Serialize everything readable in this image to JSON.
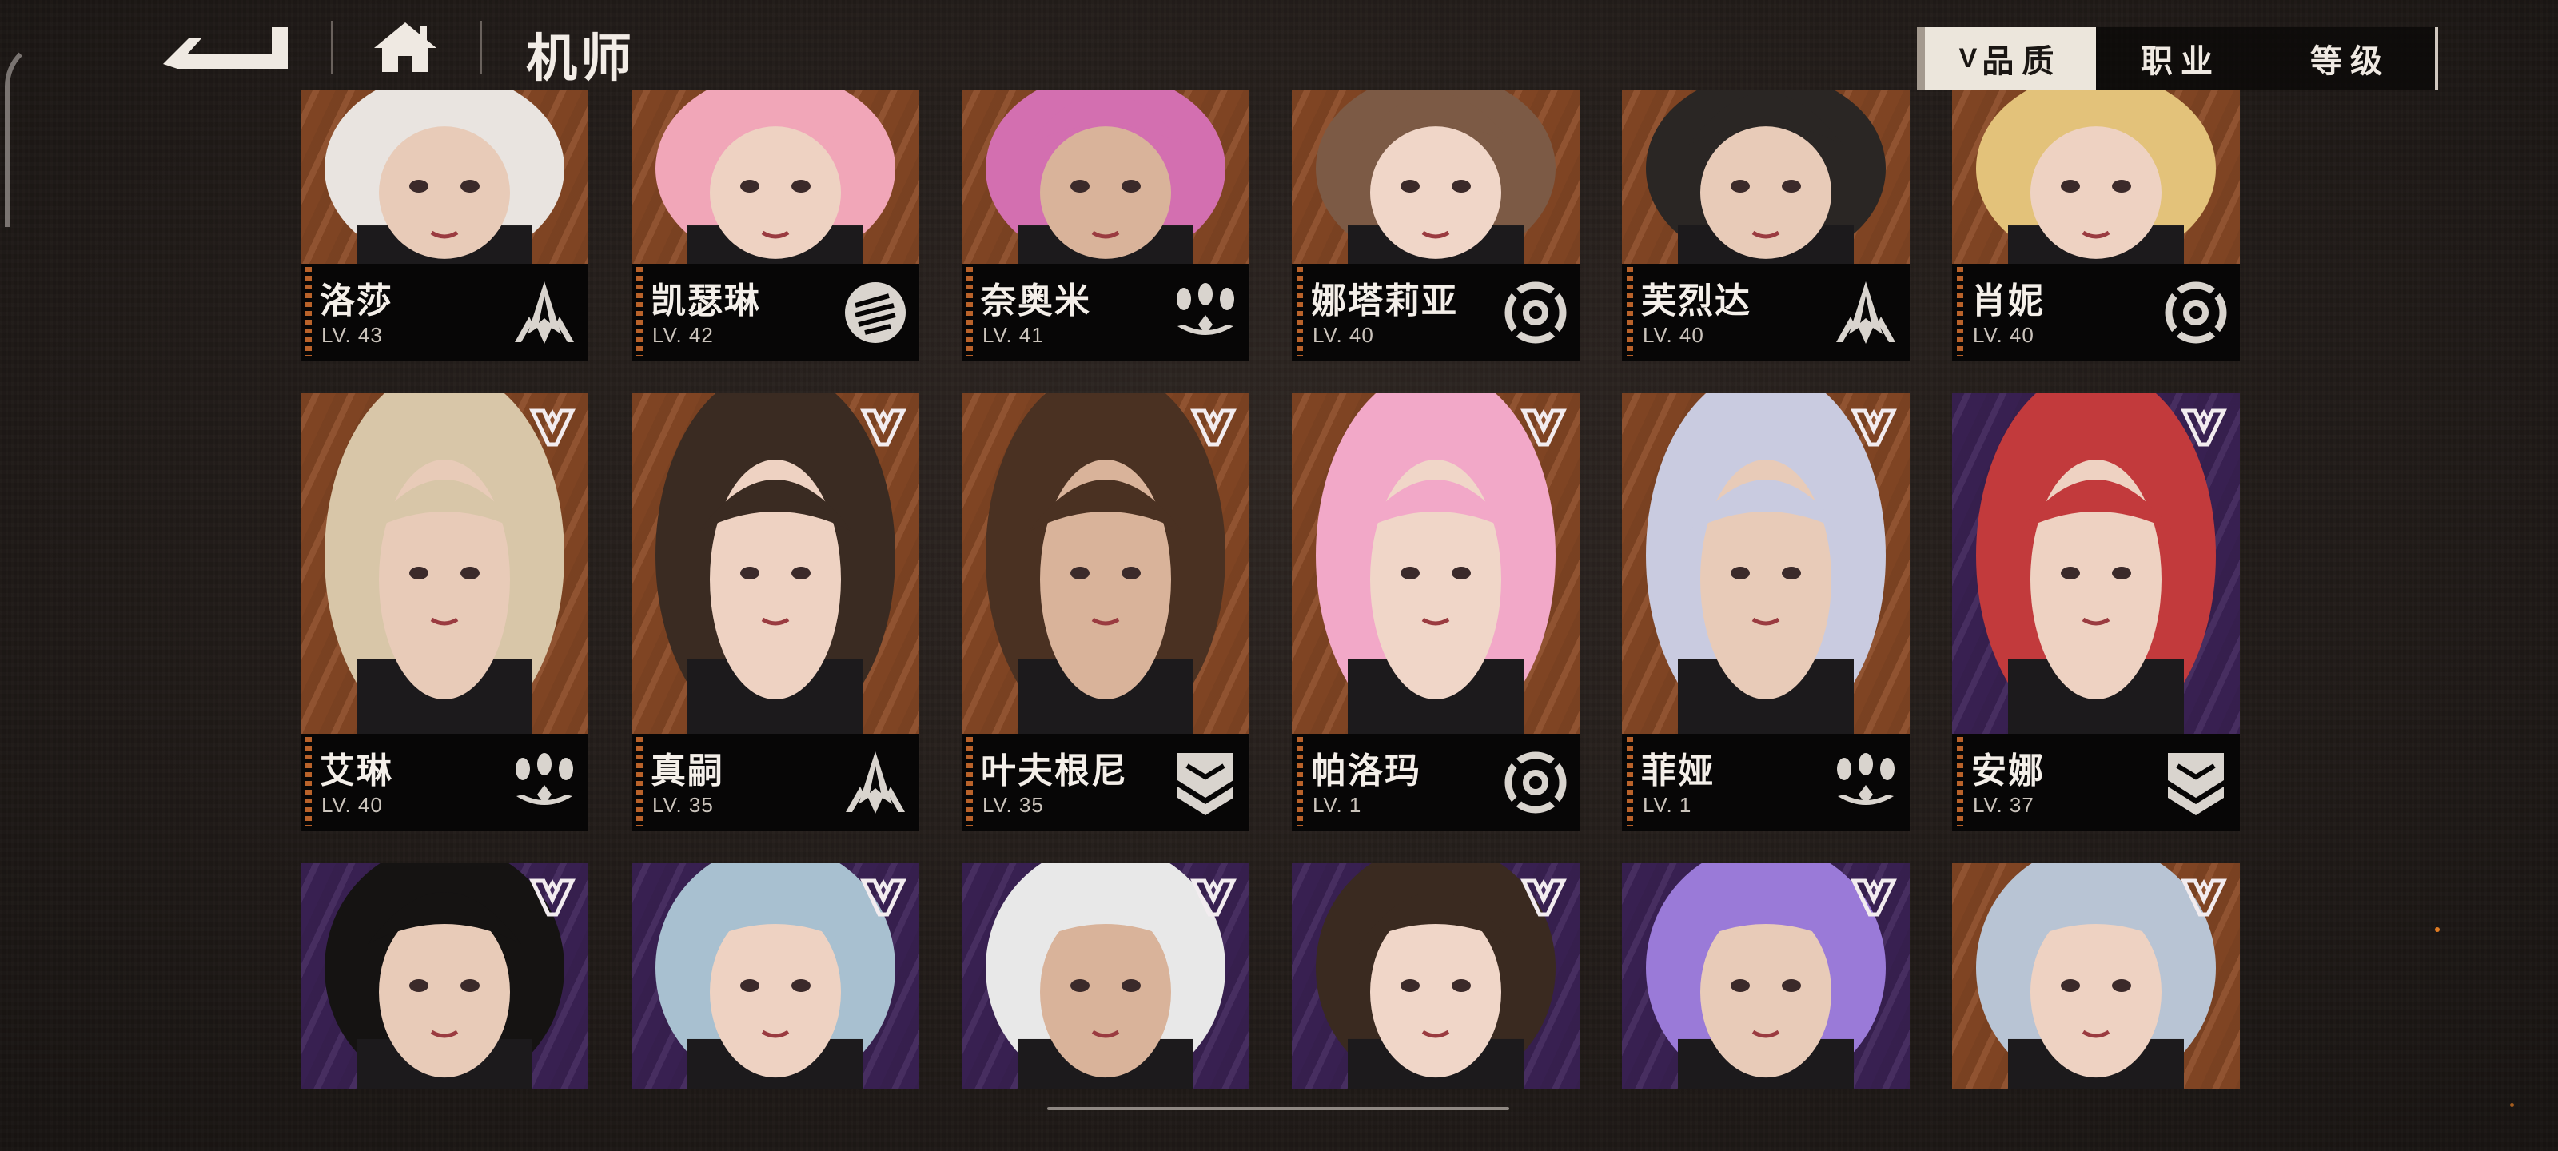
{
  "header": {
    "title": "机师",
    "back_icon": "back-arrow-icon",
    "home_icon": "home-icon"
  },
  "sort": {
    "active_chevron": "V",
    "tabs": [
      {
        "label": "品质",
        "active": true
      },
      {
        "label": "职业",
        "active": false
      },
      {
        "label": "等级",
        "active": false
      }
    ]
  },
  "colors": {
    "orange_bg": "#8a4a26",
    "purple_bg": "#3d2358",
    "accent_stripe": "#b9622a",
    "sort_active": "#ece6dc"
  },
  "pilots_row1": [
    {
      "name": "洛莎",
      "level": "LV. 43",
      "class_icon": "spike-class-icon",
      "bg": "orange"
    },
    {
      "name": "凯瑟琳",
      "level": "LV. 42",
      "class_icon": "fist-class-icon",
      "bg": "orange"
    },
    {
      "name": "奈奥米",
      "level": "LV. 41",
      "class_icon": "bombs-class-icon",
      "bg": "orange"
    },
    {
      "name": "娜塔莉亚",
      "level": "LV. 40",
      "class_icon": "target-class-icon",
      "bg": "orange"
    },
    {
      "name": "芙烈达",
      "level": "LV. 40",
      "class_icon": "spike-class-icon",
      "bg": "orange"
    },
    {
      "name": "肖妮",
      "level": "LV. 40",
      "class_icon": "target-class-icon",
      "bg": "orange"
    }
  ],
  "pilots_row2": [
    {
      "name": "艾琳",
      "level": "LV. 40",
      "class_icon": "bombs-class-icon",
      "bg": "orange"
    },
    {
      "name": "真嗣",
      "level": "LV. 35",
      "class_icon": "spike-class-icon",
      "bg": "orange"
    },
    {
      "name": "叶夫根尼",
      "level": "LV. 35",
      "class_icon": "shield-class-icon",
      "bg": "orange"
    },
    {
      "name": "帕洛玛",
      "level": "LV. 1",
      "class_icon": "target-class-icon",
      "bg": "orange"
    },
    {
      "name": "菲娅",
      "level": "LV. 1",
      "class_icon": "bombs-class-icon",
      "bg": "orange"
    },
    {
      "name": "安娜",
      "level": "LV. 37",
      "class_icon": "shield-class-icon",
      "bg": "purple"
    }
  ],
  "pilots_row3": [
    {
      "bg": "purple"
    },
    {
      "bg": "purple"
    },
    {
      "bg": "purple"
    },
    {
      "bg": "purple"
    },
    {
      "bg": "purple"
    },
    {
      "bg": "orange"
    }
  ]
}
